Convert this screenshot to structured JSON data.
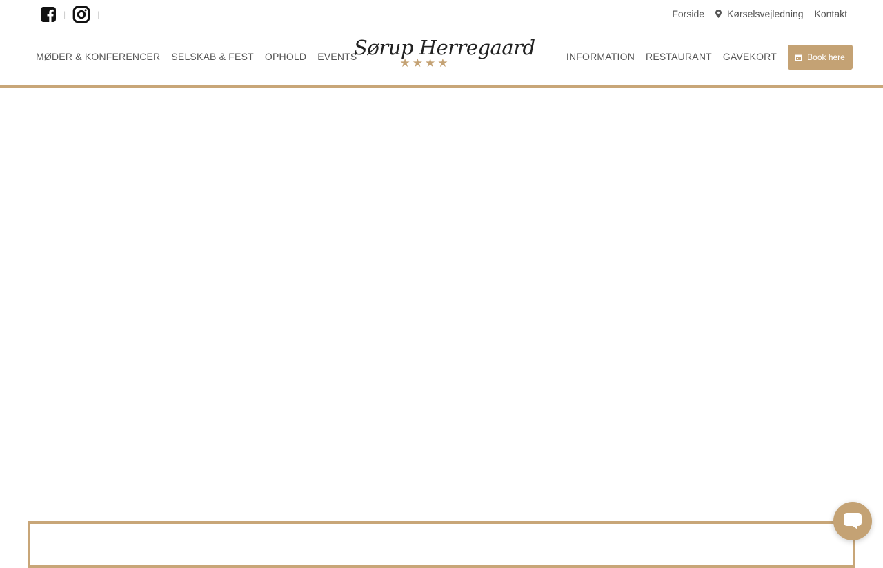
{
  "top_links": {
    "forside": "Forside",
    "directions": "Kørselsvejledning",
    "kontakt": "Kontakt"
  },
  "nav_left": [
    "MØDER & KONFERENCER",
    "SELSKAB & FEST",
    "OPHOLD",
    "EVENTS"
  ],
  "nav_right": [
    "INFORMATION",
    "RESTAURANT",
    "GAVEKORT"
  ],
  "logo": {
    "text": "Sørup Herregaard",
    "stars": "★★★★"
  },
  "book_button": {
    "label": "Book here"
  },
  "social": {
    "separator": "|"
  },
  "colors": {
    "accent": "#c4a274",
    "rule": "#c8a678",
    "text": "#555555"
  }
}
